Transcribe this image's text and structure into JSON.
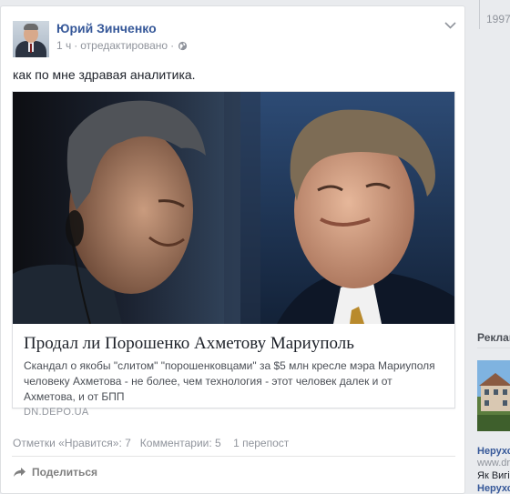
{
  "post": {
    "author": "Юрий Зинченко",
    "time": "1 ч",
    "separator": "·",
    "edited": "отредактировано",
    "separator2": "·",
    "privacy_icon": "globe-icon",
    "menu_icon": "chevron-down-icon",
    "status_text": "как по мне здравая аналитика."
  },
  "link_preview": {
    "title": "Продал ли Порошенко Ахметову Мариуполь",
    "description": "Скандал о якобы \"слитом\" \"порошенковцами\" за $5 млн кресле мэра Мариуполя человеку Ахметова - не более, чем технология - этот человек далек и от Ахметова, и от БПП",
    "source": "DN.DEPO.UA"
  },
  "stats": {
    "likes": "Отметки «Нравится»: 7",
    "comments": "Комментарии: 5",
    "shares": "1 перепост"
  },
  "actions": {
    "share_icon": "share-arrow-icon",
    "share_label": "Поделиться"
  },
  "right_column": {
    "top_text": "1997",
    "ads_header": "Реклама",
    "ad_title": "Нерухо",
    "ad_url": "www.dr",
    "ad_text": "Як Вигі",
    "ad_title2": "Нерухо"
  },
  "colors": {
    "link_blue": "#365899",
    "meta_gray": "#90949c",
    "text": "#1d2129",
    "page_bg": "#e9ebee"
  }
}
